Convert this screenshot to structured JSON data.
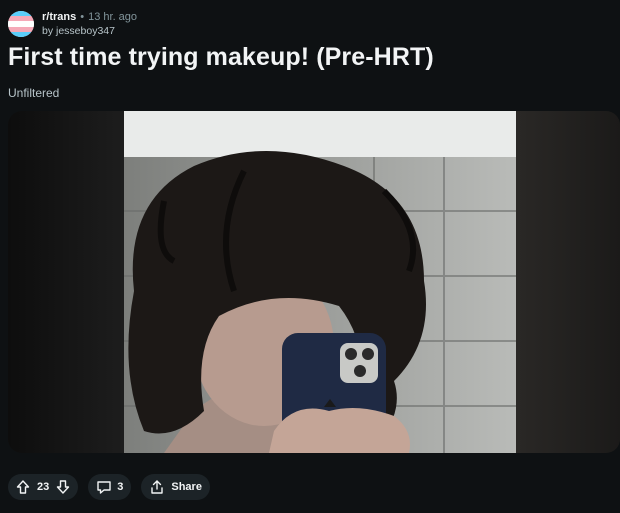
{
  "post": {
    "subreddit": "r/trans",
    "separator": "•",
    "time": "13 hr. ago",
    "author": "by jesseboy347",
    "title": "First time trying makeup! (Pre-HRT)",
    "flair": "Unfiltered"
  },
  "actions": {
    "vote_count": "23",
    "comment_count": "3",
    "share_label": "Share"
  },
  "icons": {
    "avatar": "trans-flag-icon",
    "upvote": "arrow-up-icon",
    "downvote": "arrow-down-icon",
    "comment": "comment-bubble-icon",
    "share": "share-icon"
  },
  "colors": {
    "background": "#0e1113",
    "pill": "#1c2327",
    "flag_blue": "#5bcefa",
    "flag_pink": "#f5a9b8",
    "flag_white": "#ffffff"
  }
}
